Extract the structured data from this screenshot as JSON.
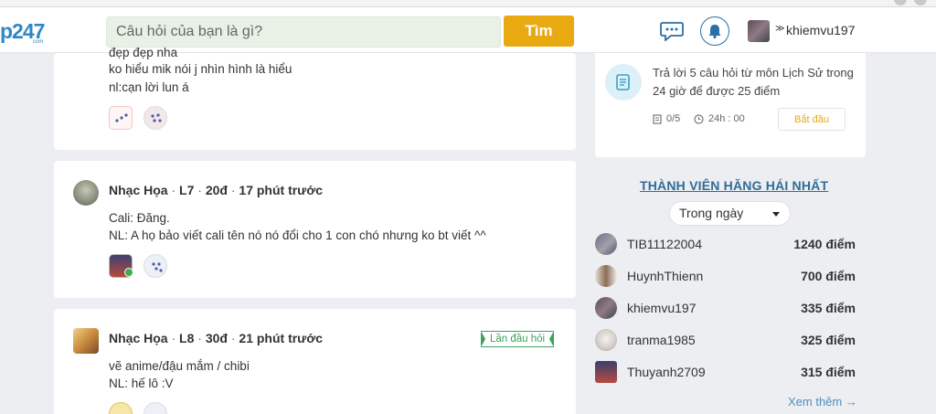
{
  "header": {
    "logo_text": "p247",
    "logo_sub": "com",
    "search_placeholder": "Câu hỏi của bạn là gì?",
    "search_button": "Tìm",
    "username": "khiemvu197",
    "chevron": "≫",
    "icons": [
      "message-icon",
      "bell-icon"
    ]
  },
  "feed": [
    {
      "lines": [
        "đẹp đẹp nha",
        "ko hiểu mik nói j nhìn hình là hiểu",
        "nl:cạn lời lun á"
      ]
    },
    {
      "author": "Nhạc Họa",
      "level": "L7",
      "points": "20đ",
      "time": "17 phút trước",
      "lines": [
        "Cali: Đăng.",
        "NL: A họ bảo viết cali tên nó nó đổi cho 1 con chó nhưng ko bt viết ^^"
      ]
    },
    {
      "author": "Nhạc Họa",
      "level": "L8",
      "points": "30đ",
      "time": "21 phút trước",
      "badge": "Lần đầu hỏi",
      "lines": [
        "vẽ anime/đậu mắm / chibi",
        "NL: hế lô :V"
      ]
    }
  ],
  "separator": "·",
  "task": {
    "text": "Trả lời 5 câu hỏi  từ môn Lịch Sử trong 24 giờ để được 25 điểm",
    "progress": "0/5",
    "duration": "24h : 00",
    "start_button": "Bắt đầu"
  },
  "members": {
    "title": "THÀNH VIÊN HĂNG HÁI NHẤT",
    "period": "Trong ngày",
    "list": [
      {
        "name": "TIB11122004",
        "points": "1240 điểm"
      },
      {
        "name": "HuynhThienn",
        "points": "700 điểm"
      },
      {
        "name": "khiemvu197",
        "points": "335 điểm"
      },
      {
        "name": "tranma1985",
        "points": "325 điểm"
      },
      {
        "name": "Thuyanh2709",
        "points": "315 điểm"
      }
    ],
    "see_more": "Xem thêm",
    "see_more_arrow": "→"
  }
}
